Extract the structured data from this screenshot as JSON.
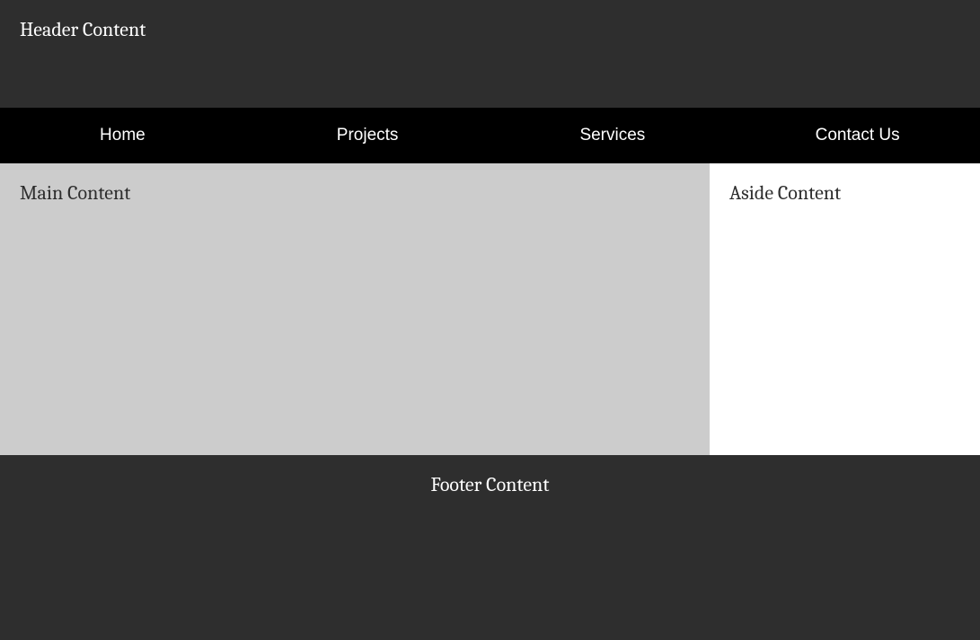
{
  "header": {
    "title": "Header Content"
  },
  "nav": {
    "items": [
      {
        "label": "Home"
      },
      {
        "label": "Projects"
      },
      {
        "label": "Services"
      },
      {
        "label": "Contact Us"
      }
    ]
  },
  "main": {
    "title": "Main Content"
  },
  "aside": {
    "title": "Aside Content"
  },
  "footer": {
    "title": "Footer Content"
  }
}
